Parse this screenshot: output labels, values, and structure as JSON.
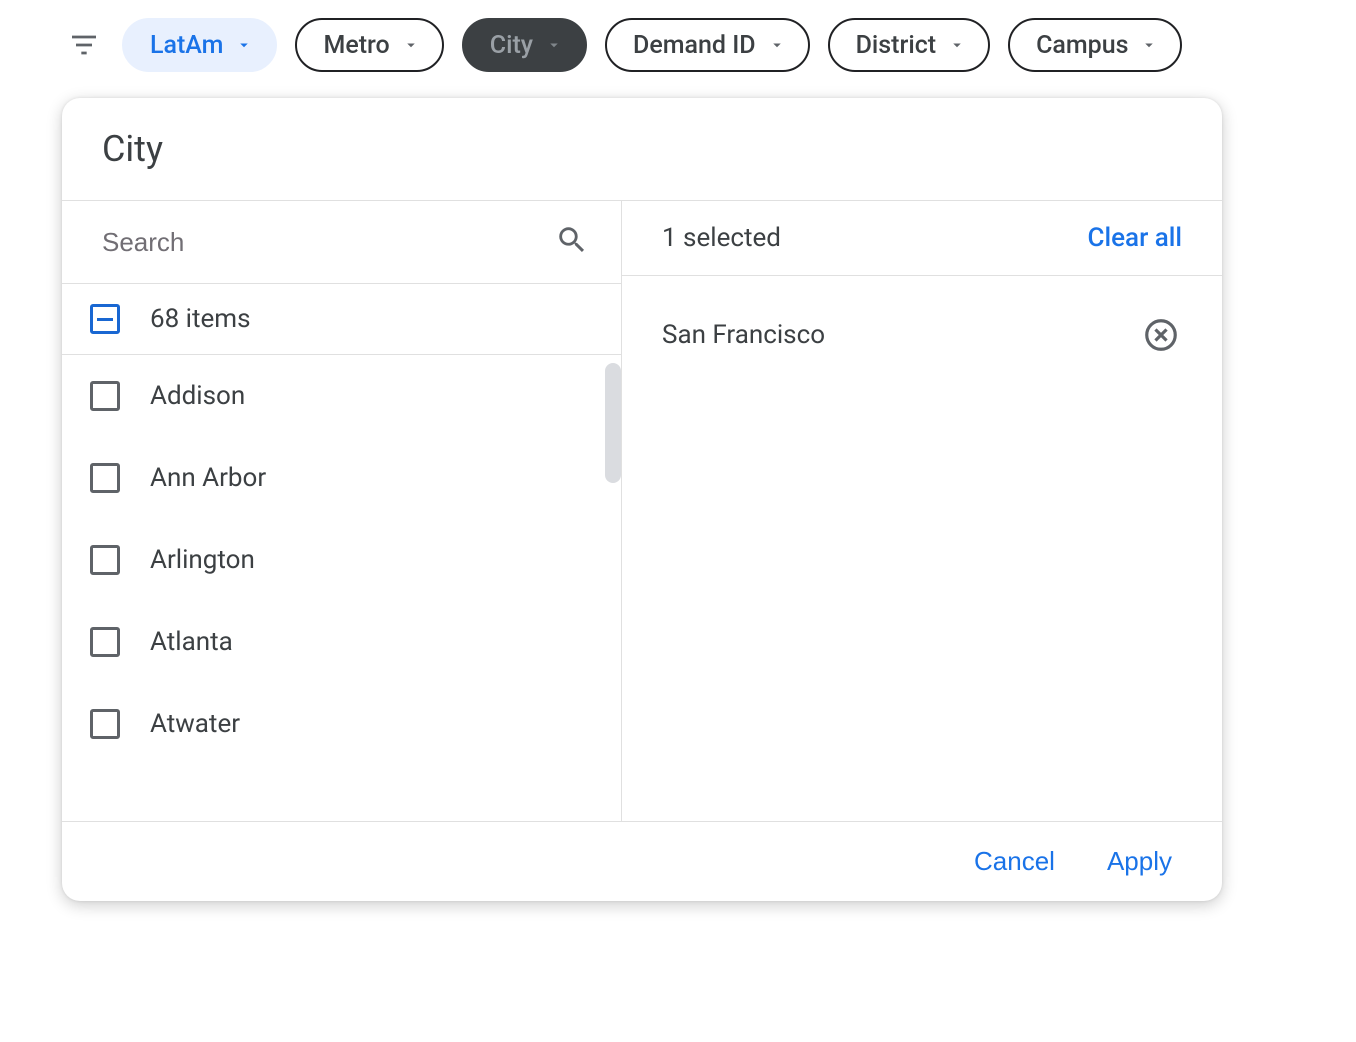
{
  "chips": [
    {
      "label": "LatAm",
      "state": "selected"
    },
    {
      "label": "Metro",
      "state": "normal"
    },
    {
      "label": "City",
      "state": "active"
    },
    {
      "label": "Demand ID",
      "state": "normal"
    },
    {
      "label": "District",
      "state": "normal"
    },
    {
      "label": "Campus",
      "state": "normal"
    }
  ],
  "panel": {
    "title": "City",
    "search_placeholder": "Search",
    "summary_label": "68 items",
    "items": [
      {
        "label": "Addison"
      },
      {
        "label": "Ann Arbor"
      },
      {
        "label": "Arlington"
      },
      {
        "label": "Atlanta"
      },
      {
        "label": "Atwater"
      }
    ],
    "selected_header": "1 selected",
    "clear_all_label": "Clear all",
    "selected": [
      {
        "label": "San Francisco"
      }
    ],
    "cancel_label": "Cancel",
    "apply_label": "Apply"
  }
}
